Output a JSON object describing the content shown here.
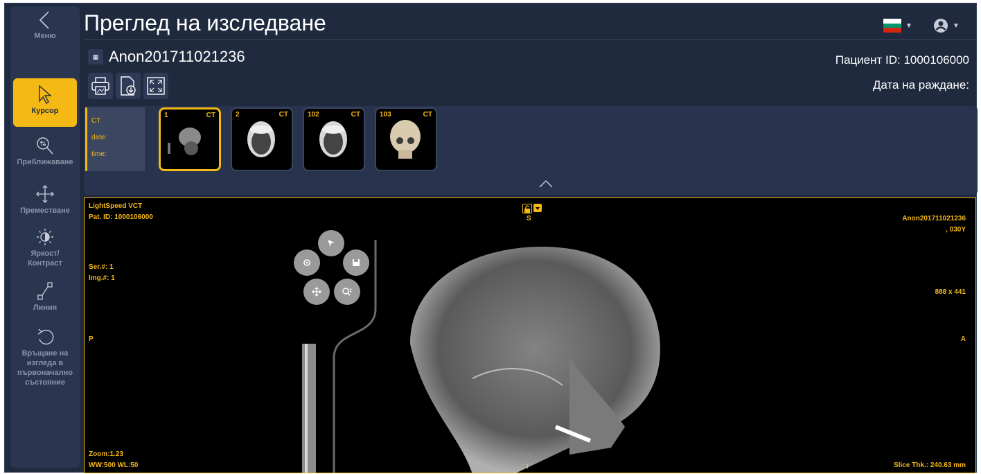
{
  "app": {
    "title": "Преглед на изследване",
    "accent_color": "#f5b916",
    "background_color": "#1f2a3e"
  },
  "sidebar": {
    "menu_label": "Меню",
    "items": [
      {
        "label": "Курсор",
        "icon": "cursor-icon",
        "active": true
      },
      {
        "label": "Приближаване",
        "icon": "zoom-icon",
        "active": false
      },
      {
        "label": "Преместване",
        "icon": "move-icon",
        "active": false
      },
      {
        "label": "Яркост/\nКонтраст",
        "label_line1": "Яркост/",
        "label_line2": "Контраст",
        "icon": "brightness-contrast-icon",
        "active": false
      },
      {
        "label": "Линия",
        "icon": "line-icon",
        "active": false
      },
      {
        "label": "Връщане на изгледа в първоначално състояние",
        "label_line1": "Връщане на",
        "label_line2": "изгледа в",
        "label_line3": "първоначално",
        "label_line4": "състояние",
        "icon": "reset-icon",
        "active": false
      }
    ]
  },
  "header": {
    "language_flag": "bulgarian-flag-icon",
    "user_icon": "user-icon"
  },
  "study": {
    "name": "Anon201711021236",
    "patient_id_label": "Пациент ID: 1000106000",
    "birth_date_label": "Дата на раждане:",
    "tools": [
      "print-icon",
      "download-icon",
      "fullscreen-icon"
    ]
  },
  "series": {
    "info": {
      "modality": "CT",
      "date_label": "date:",
      "time_label": "time:"
    },
    "thumbnails": [
      {
        "number": "1",
        "modality": "CT",
        "selected": true
      },
      {
        "number": "2",
        "modality": "CT",
        "selected": false
      },
      {
        "number": "102",
        "modality": "CT",
        "selected": false
      },
      {
        "number": "103",
        "modality": "CT",
        "selected": false
      }
    ]
  },
  "viewer": {
    "top_left": {
      "device": "LightSpeed VCT",
      "pat_id": "Pat. ID: 1000106000"
    },
    "series_info": {
      "ser": "Ser.#: 1",
      "img": "Img.#: 1"
    },
    "top_right": {
      "patient": "Anon201711021236",
      "age": ", 030Y"
    },
    "dimensions": "888 x 441",
    "orientation": {
      "top": "S",
      "left": "P",
      "right": "A",
      "bottom": "I"
    },
    "bottom_left": {
      "zoom": "Zoom:1.23",
      "window": "WW:500 WL:50"
    },
    "bottom_right": {
      "slice": "Slice Thk.: 240.63 mm"
    },
    "radial_menu": [
      "cursor-icon",
      "settings-icon",
      "save-icon",
      "move-icon",
      "zoom-icon"
    ]
  }
}
